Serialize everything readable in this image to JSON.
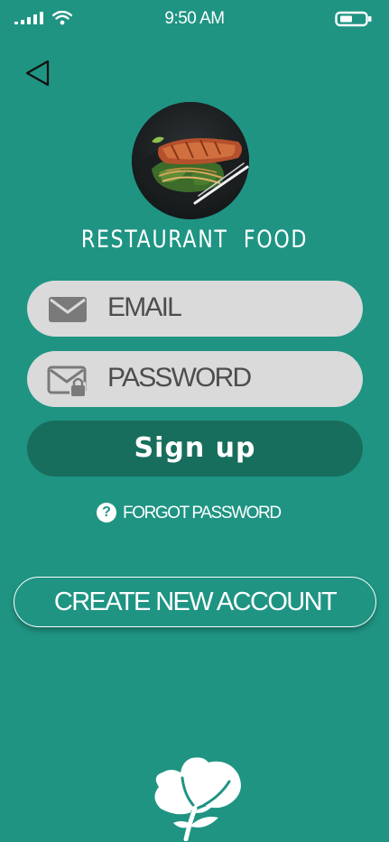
{
  "status_bar": {
    "time": "9:50 AM",
    "signal_icon": "signal-bars-icon",
    "wifi_icon": "wifi-icon",
    "battery_icon": "battery-icon"
  },
  "nav": {
    "back_icon": "back-triangle-icon"
  },
  "header": {
    "logo_image": "food-photo",
    "app_name": "RESTAURANT  FOOD"
  },
  "form": {
    "email_label": "EMAIL",
    "email_icon": "envelope-icon",
    "password_label": "PASSWORD",
    "password_icon": "envelope-lock-icon",
    "signup_label": "Sign up",
    "forgot_label": "FORGOT PASSWORD",
    "forgot_icon": "question-circle-icon",
    "create_label": "CREATE NEW ACCOUNT"
  },
  "footer": {
    "logo_icon": "leaf-logo-icon"
  },
  "colors": {
    "background": "#1f9483",
    "input_bg": "#dadada",
    "input_text": "#4d4d4d",
    "primary_button": "#186e5c",
    "text": "#ffffff"
  }
}
